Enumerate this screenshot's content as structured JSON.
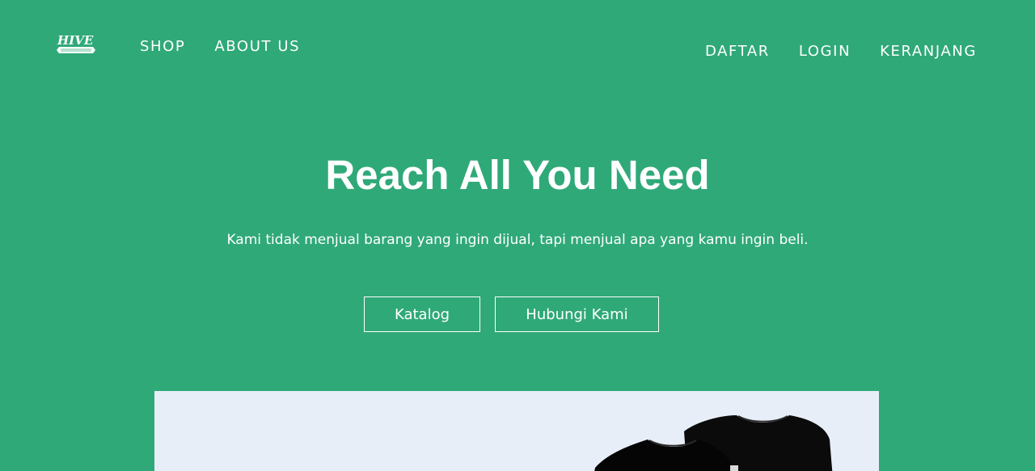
{
  "header": {
    "logo_text": "HIVE",
    "logo_subtext": "CLOTHING",
    "nav_left": [
      {
        "label": "SHOP"
      },
      {
        "label": "ABOUT US"
      }
    ],
    "nav_right": [
      {
        "label": "DAFTAR"
      },
      {
        "label": "LOGIN"
      },
      {
        "label": "KERANJANG"
      }
    ]
  },
  "hero": {
    "title": "Reach All You Need",
    "subtitle": "Kami tidak menjual barang yang ingin dijual, tapi menjual apa yang kamu ingin beli.",
    "buttons": {
      "katalog": "Katalog",
      "contact": "Hubungi Kami"
    },
    "image": {
      "description": "",
      "background_color": "#e8eef8"
    }
  },
  "colors": {
    "background": "#2fa978",
    "text": "#ffffff"
  }
}
